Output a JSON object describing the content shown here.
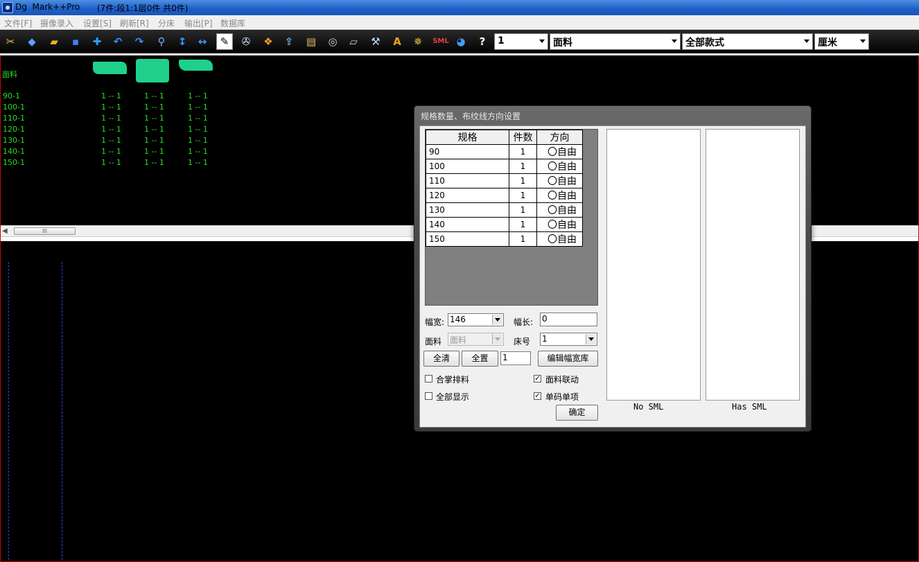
{
  "window": {
    "title": "Dg  Mark++Pro",
    "info": "(7件:段1:1层0件 共0件)"
  },
  "menu": [
    "文件[F]",
    "摄像录入",
    "设置[S]",
    "刷新[R]",
    "分床",
    "输出[P]",
    "数据库"
  ],
  "toolbar": {
    "icons": [
      {
        "name": "scissors-icon",
        "glyph": "✂",
        "color": "#e8c040"
      },
      {
        "name": "layers-icon",
        "glyph": "◆",
        "color": "#5aa0ff"
      },
      {
        "name": "open-folder-icon",
        "glyph": "▰",
        "color": "#f0b020"
      },
      {
        "name": "save-icon",
        "glyph": "▪",
        "color": "#4080ff"
      },
      {
        "name": "add-icon",
        "glyph": "✚",
        "color": "#30a0ff"
      },
      {
        "name": "undo-icon",
        "glyph": "↶",
        "color": "#3a8fff"
      },
      {
        "name": "redo-icon",
        "glyph": "↷",
        "color": "#3a8fff"
      },
      {
        "name": "zoom-icon",
        "glyph": "⚲",
        "color": "#6ab0ff"
      },
      {
        "name": "vertical-arrow-icon",
        "glyph": "↕",
        "color": "#3a9aff"
      },
      {
        "name": "horizontal-arrow-icon",
        "glyph": "↔",
        "color": "#3a9aff"
      },
      {
        "name": "select-tool-icon",
        "glyph": "✎",
        "color": "#000"
      },
      {
        "name": "reel-icon",
        "glyph": "✇",
        "color": "#cfe0ff"
      },
      {
        "name": "pattern-icon",
        "glyph": "❖",
        "color": "#f0a030"
      },
      {
        "name": "export-icon",
        "glyph": "⇪",
        "color": "#70b0e0"
      },
      {
        "name": "film-icon",
        "glyph": "▤",
        "color": "#e0c060"
      },
      {
        "name": "tape-icon",
        "glyph": "◎",
        "color": "#d0d0d0"
      },
      {
        "name": "ruler-icon",
        "glyph": "▱",
        "color": "#c0d8ff"
      },
      {
        "name": "tools-icon",
        "glyph": "⚒",
        "color": "#c0d8ff"
      },
      {
        "name": "text-icon",
        "glyph": "A",
        "color": "#f0a020"
      },
      {
        "name": "wheel-icon",
        "glyph": "✵",
        "color": "#f0c040"
      },
      {
        "name": "sml-icon",
        "glyph": "SML",
        "color": "#e04040"
      },
      {
        "name": "globe-icon",
        "glyph": "◕",
        "color": "#40a0ff"
      },
      {
        "name": "help-icon",
        "glyph": "?",
        "color": "#ffffff"
      }
    ],
    "dropdowns": [
      "1",
      "面料",
      "全部款式",
      "厘米"
    ]
  },
  "marker": {
    "fabric_label": "面料",
    "rows": [
      {
        "size": "90-1",
        "cells": [
          "1 -- 1",
          "1 -- 1",
          "1 -- 1"
        ]
      },
      {
        "size": "100-1",
        "cells": [
          "1 -- 1",
          "1 -- 1",
          "1 -- 1"
        ]
      },
      {
        "size": "110-1",
        "cells": [
          "1 -- 1",
          "1 -- 1",
          "1 -- 1"
        ]
      },
      {
        "size": "120-1",
        "cells": [
          "1 -- 1",
          "1 -- 1",
          "1 -- 1"
        ]
      },
      {
        "size": "130-1",
        "cells": [
          "1 -- 1",
          "1 -- 1",
          "1 -- 1"
        ]
      },
      {
        "size": "140-1",
        "cells": [
          "1 -- 1",
          "1 -- 1",
          "1 -- 1"
        ]
      },
      {
        "size": "150-1",
        "cells": [
          "1 -- 1",
          "1 -- 1",
          "1 -- 1"
        ]
      }
    ],
    "piece_color": "#1fd08a"
  },
  "scroll": {
    "thumb_grip": "III"
  },
  "dialog": {
    "title": "规格数量、布纹线方向设置",
    "table": {
      "headers": [
        "规格",
        "件数",
        "方向"
      ],
      "rows": [
        {
          "spec": "90",
          "count": "1",
          "direction": "〇自由"
        },
        {
          "spec": "100",
          "count": "1",
          "direction": "〇自由"
        },
        {
          "spec": "110",
          "count": "1",
          "direction": "〇自由"
        },
        {
          "spec": "120",
          "count": "1",
          "direction": "〇自由"
        },
        {
          "spec": "130",
          "count": "1",
          "direction": "〇自由"
        },
        {
          "spec": "140",
          "count": "1",
          "direction": "〇自由"
        },
        {
          "spec": "150",
          "count": "1",
          "direction": "〇自由"
        }
      ]
    },
    "width_label": "幅宽:",
    "width_value": "146",
    "length_label": "幅长:",
    "length_value": "0",
    "fabric_label": "面料",
    "fabric_value": "面料",
    "bed_label": "床号",
    "bed_value": "1",
    "clear_all": "全清",
    "set_all": "全置",
    "set_all_value": "1",
    "edit_width_lib": "编辑幅宽库",
    "checkboxes": {
      "combine": {
        "label": "合掌排料",
        "checked": false
      },
      "fabric_link": {
        "label": "面料联动",
        "checked": true
      },
      "show_all": {
        "label": "全部显示",
        "checked": false
      },
      "single_size": {
        "label": "单码单项",
        "checked": true
      }
    },
    "ok": "确定",
    "no_sml": "No SML",
    "has_sml": "Has SML"
  }
}
